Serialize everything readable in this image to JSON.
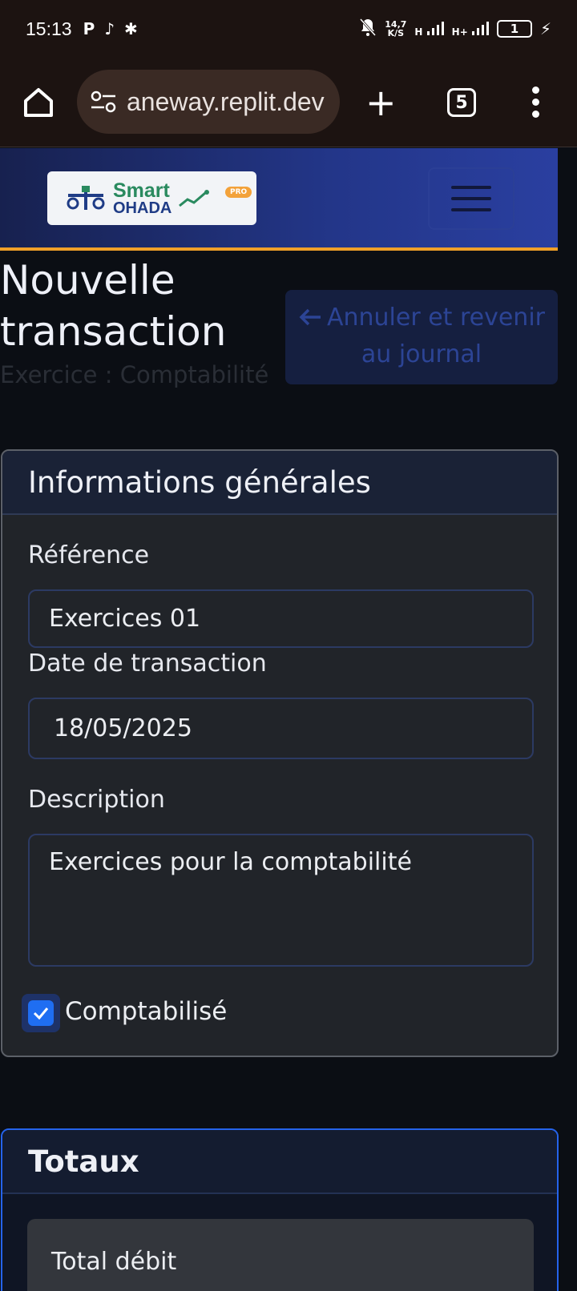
{
  "status_bar": {
    "time": "15:13",
    "net_speed_top": "14,7",
    "net_speed_bottom": "K/S",
    "signal1": "H",
    "signal2": "H+",
    "battery": "1"
  },
  "browser": {
    "url": "aneway.replit.dev",
    "tab_count": "5"
  },
  "header": {
    "logo_smart": "Smart",
    "logo_ohada": "OHADA",
    "logo_badge": "PRO"
  },
  "page": {
    "title": "Nouvelle transaction",
    "subtitle": "Exercice : Comptabilité",
    "cancel_button": "Annuler et revenir au journal"
  },
  "general": {
    "heading": "Informations générales",
    "reference_label": "Référence",
    "reference_value": "Exercices 01",
    "date_label": "Date de transaction",
    "date_value": "18/05/2025",
    "description_label": "Description",
    "description_value": "Exercices pour la comptabilité",
    "posted_label": "Comptabilisé",
    "posted_checked": true
  },
  "totals": {
    "heading": "Totaux",
    "total_debit_label": "Total débit"
  },
  "colors": {
    "accent": "#f0a028",
    "primary": "#1f6ef2",
    "header_start": "#17214f",
    "header_end": "#2a3fa0"
  }
}
